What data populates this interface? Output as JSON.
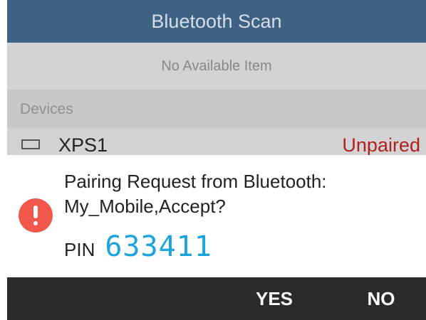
{
  "header": {
    "title": "Bluetooth Scan"
  },
  "available": {
    "empty_text": "No Available Item"
  },
  "devices": {
    "section_label": "Devices",
    "items": [
      {
        "name": "XPS1",
        "status": "Unpaired",
        "icon": "device-icon"
      }
    ]
  },
  "dialog": {
    "icon": "alert-icon",
    "message_line1": "Pairing Request from Bluetooth:",
    "message_line2": "My_Mobile,Accept?",
    "pin_label": "PIN",
    "pin_value": "633411"
  },
  "actions": {
    "yes_label": "YES",
    "no_label": "NO"
  },
  "colors": {
    "title_bar": "#3d6283",
    "unpaired_status": "#b02020",
    "alert": "#f1574b",
    "pin": "#1ba3de",
    "action_bar": "#2b2b2b"
  }
}
